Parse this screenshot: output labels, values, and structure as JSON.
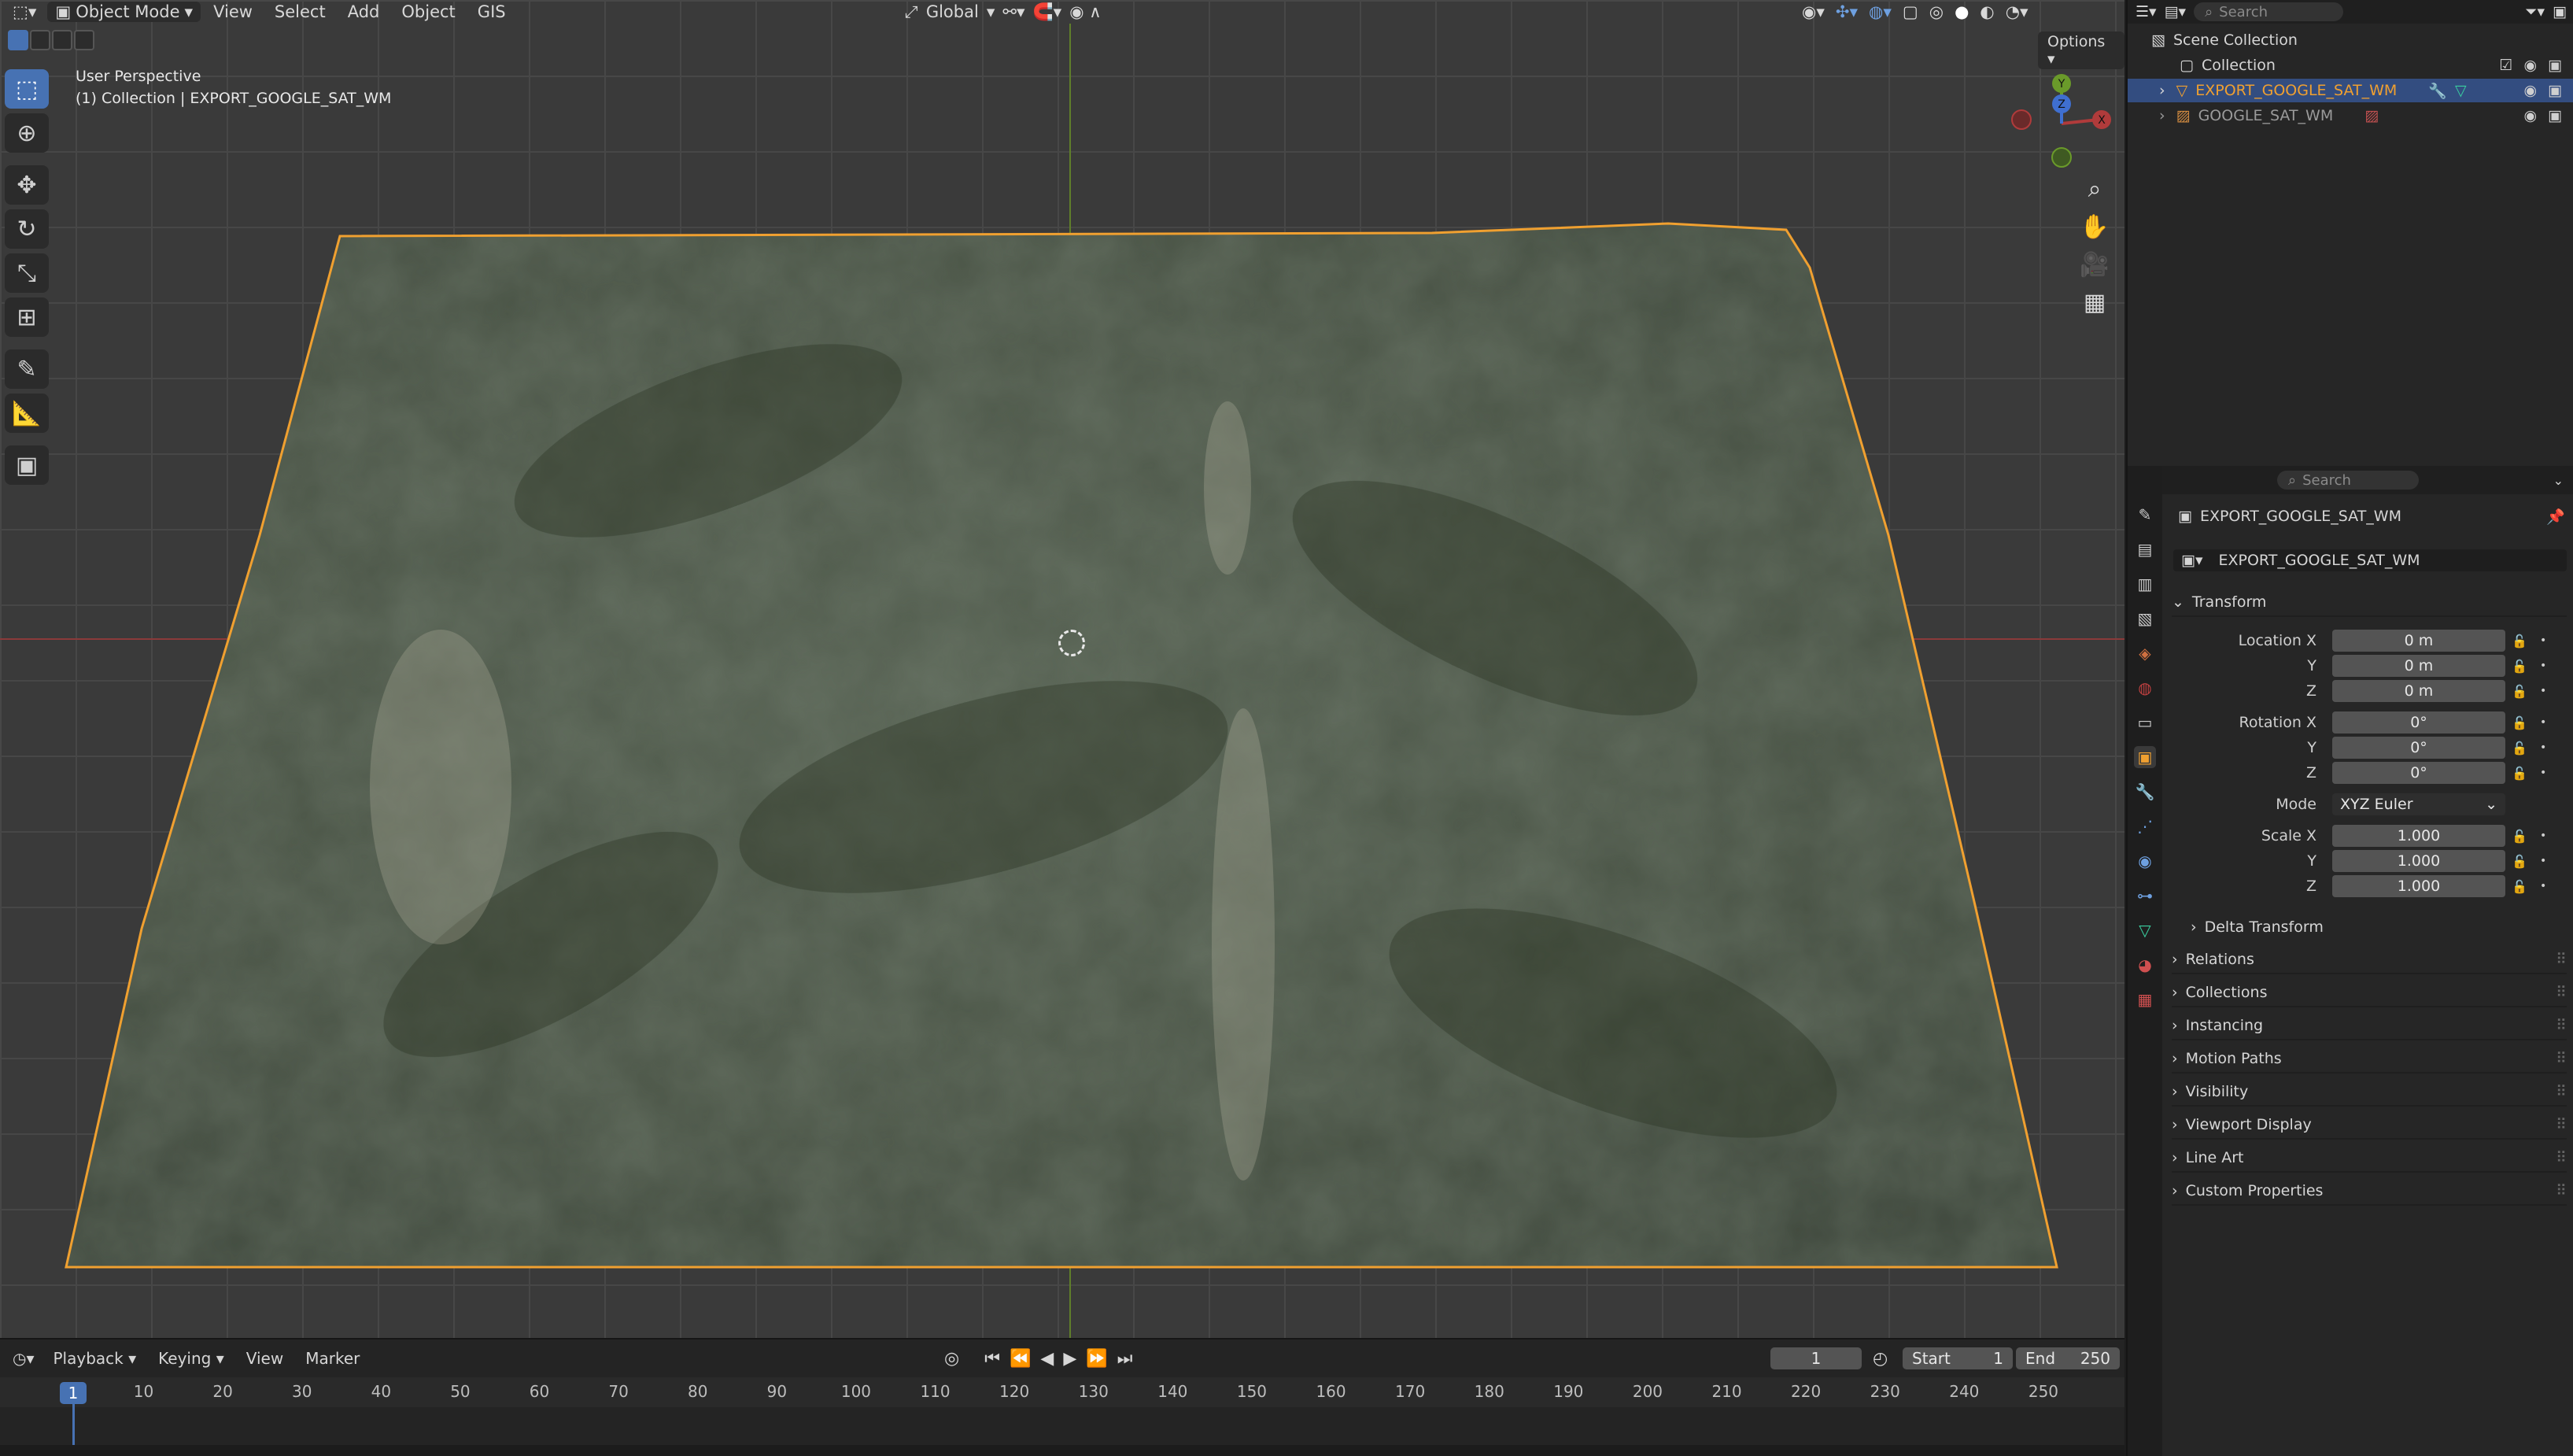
{
  "viewport": {
    "mode": "Object Mode",
    "menus": [
      "View",
      "Select",
      "Add",
      "Object",
      "GIS"
    ],
    "transform_orientation": "Global",
    "options_label": "Options",
    "perspective_label": "User Perspective",
    "collection_label": "(1) Collection | EXPORT_GOOGLE_SAT_WM",
    "tools": [
      "select-box-icon",
      "cursor-icon",
      "move-icon",
      "rotate-icon",
      "scale-icon",
      "transform-icon",
      "annotate-icon",
      "measure-icon",
      "add-cube-icon"
    ],
    "gizmo_axes": {
      "x": "X",
      "y": "Y",
      "z": "Z"
    },
    "colors": {
      "selection_outline": "#f0a030",
      "axis_x": "#b03b3b",
      "axis_y": "#6a9a2a",
      "accent": "#4772b3"
    }
  },
  "timeline": {
    "menus": [
      "Playback",
      "Keying",
      "View",
      "Marker"
    ],
    "current_frame": "1",
    "start_label": "Start",
    "start": "1",
    "end_label": "End",
    "end": "250",
    "ruler": [
      "1",
      "10",
      "20",
      "30",
      "40",
      "50",
      "60",
      "70",
      "80",
      "90",
      "100",
      "110",
      "120",
      "130",
      "140",
      "150",
      "160",
      "170",
      "180",
      "190",
      "200",
      "210",
      "220",
      "230",
      "240",
      "250"
    ]
  },
  "outliner": {
    "search_placeholder": "Search",
    "scene_collection": "Scene Collection",
    "collection": "Collection",
    "items": [
      {
        "name": "EXPORT_GOOGLE_SAT_WM",
        "selected": true
      },
      {
        "name": "GOOGLE_SAT_WM",
        "selected": false
      }
    ]
  },
  "properties": {
    "search_placeholder": "Search",
    "object_name": "EXPORT_GOOGLE_SAT_WM",
    "object_field": "EXPORT_GOOGLE_SAT_WM",
    "transform": {
      "title": "Transform",
      "location_label": "Location X",
      "location": [
        "0 m",
        "0 m",
        "0 m"
      ],
      "rotation_label": "Rotation X",
      "rotation": [
        "0°",
        "0°",
        "0°"
      ],
      "mode_label": "Mode",
      "mode": "XYZ Euler",
      "scale_label": "Scale X",
      "scale": [
        "1.000",
        "1.000",
        "1.000"
      ],
      "y_label": "Y",
      "z_label": "Z",
      "delta": "Delta Transform"
    },
    "panels": [
      "Relations",
      "Collections",
      "Instancing",
      "Motion Paths",
      "Visibility",
      "Viewport Display",
      "Line Art",
      "Custom Properties"
    ]
  }
}
